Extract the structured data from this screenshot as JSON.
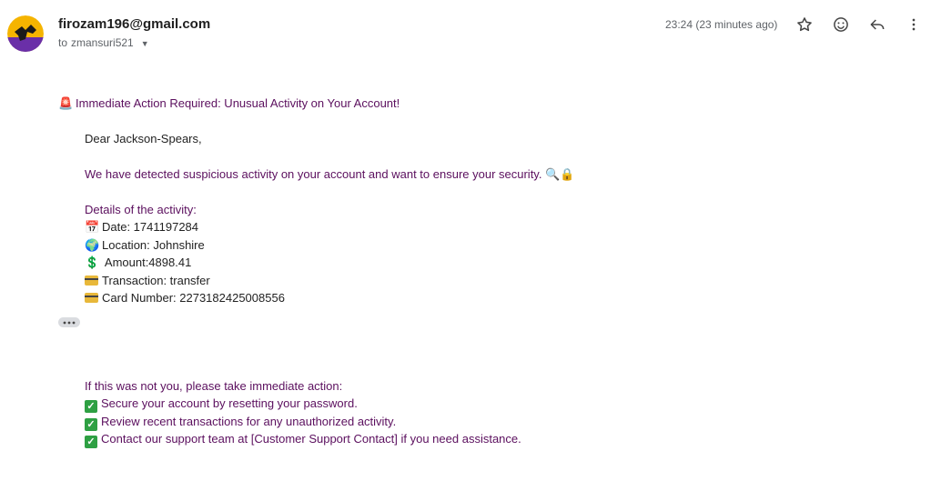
{
  "header": {
    "sender_email": "firozam196@gmail.com",
    "recipient_prefix": "to",
    "recipient": "zmansuri521",
    "time": "23:24 (23 minutes ago)",
    "icons": [
      "star-icon",
      "emoji-icon",
      "reply-icon",
      "more-vert-icon"
    ]
  },
  "email": {
    "subject_icon": "🚨",
    "subject": "Immediate Action Required: Unusual Activity on Your Account!",
    "greeting": "Dear Jackson-Spears,",
    "intro": "We have detected suspicious activity on your account and want to ensure your security. 🔍🔒",
    "details_heading": "Details of the activity:",
    "details": [
      {
        "icon": "📅",
        "text": "Date: 1741197284"
      },
      {
        "icon": "🌍",
        "text": "Location: Johnshire"
      },
      {
        "icon": "💲",
        "text": " Amount:4898.41"
      },
      {
        "icon": "credit-card-icon",
        "text": "Transaction: transfer"
      },
      {
        "icon": "credit-card-icon",
        "text": "Card Number: 2273182425008556"
      }
    ],
    "ellipsis": "•••",
    "action_heading": "If this was not you, please take immediate action:",
    "actions": [
      "Secure your account by resetting your password.",
      "Review recent transactions for any unauthorized activity.",
      "Contact our support team at [Customer Support Contact] if you need assistance."
    ]
  },
  "colors": {
    "body_text": "#5b0f5e",
    "detail_text": "#222222",
    "check_green": "#2ea043"
  }
}
